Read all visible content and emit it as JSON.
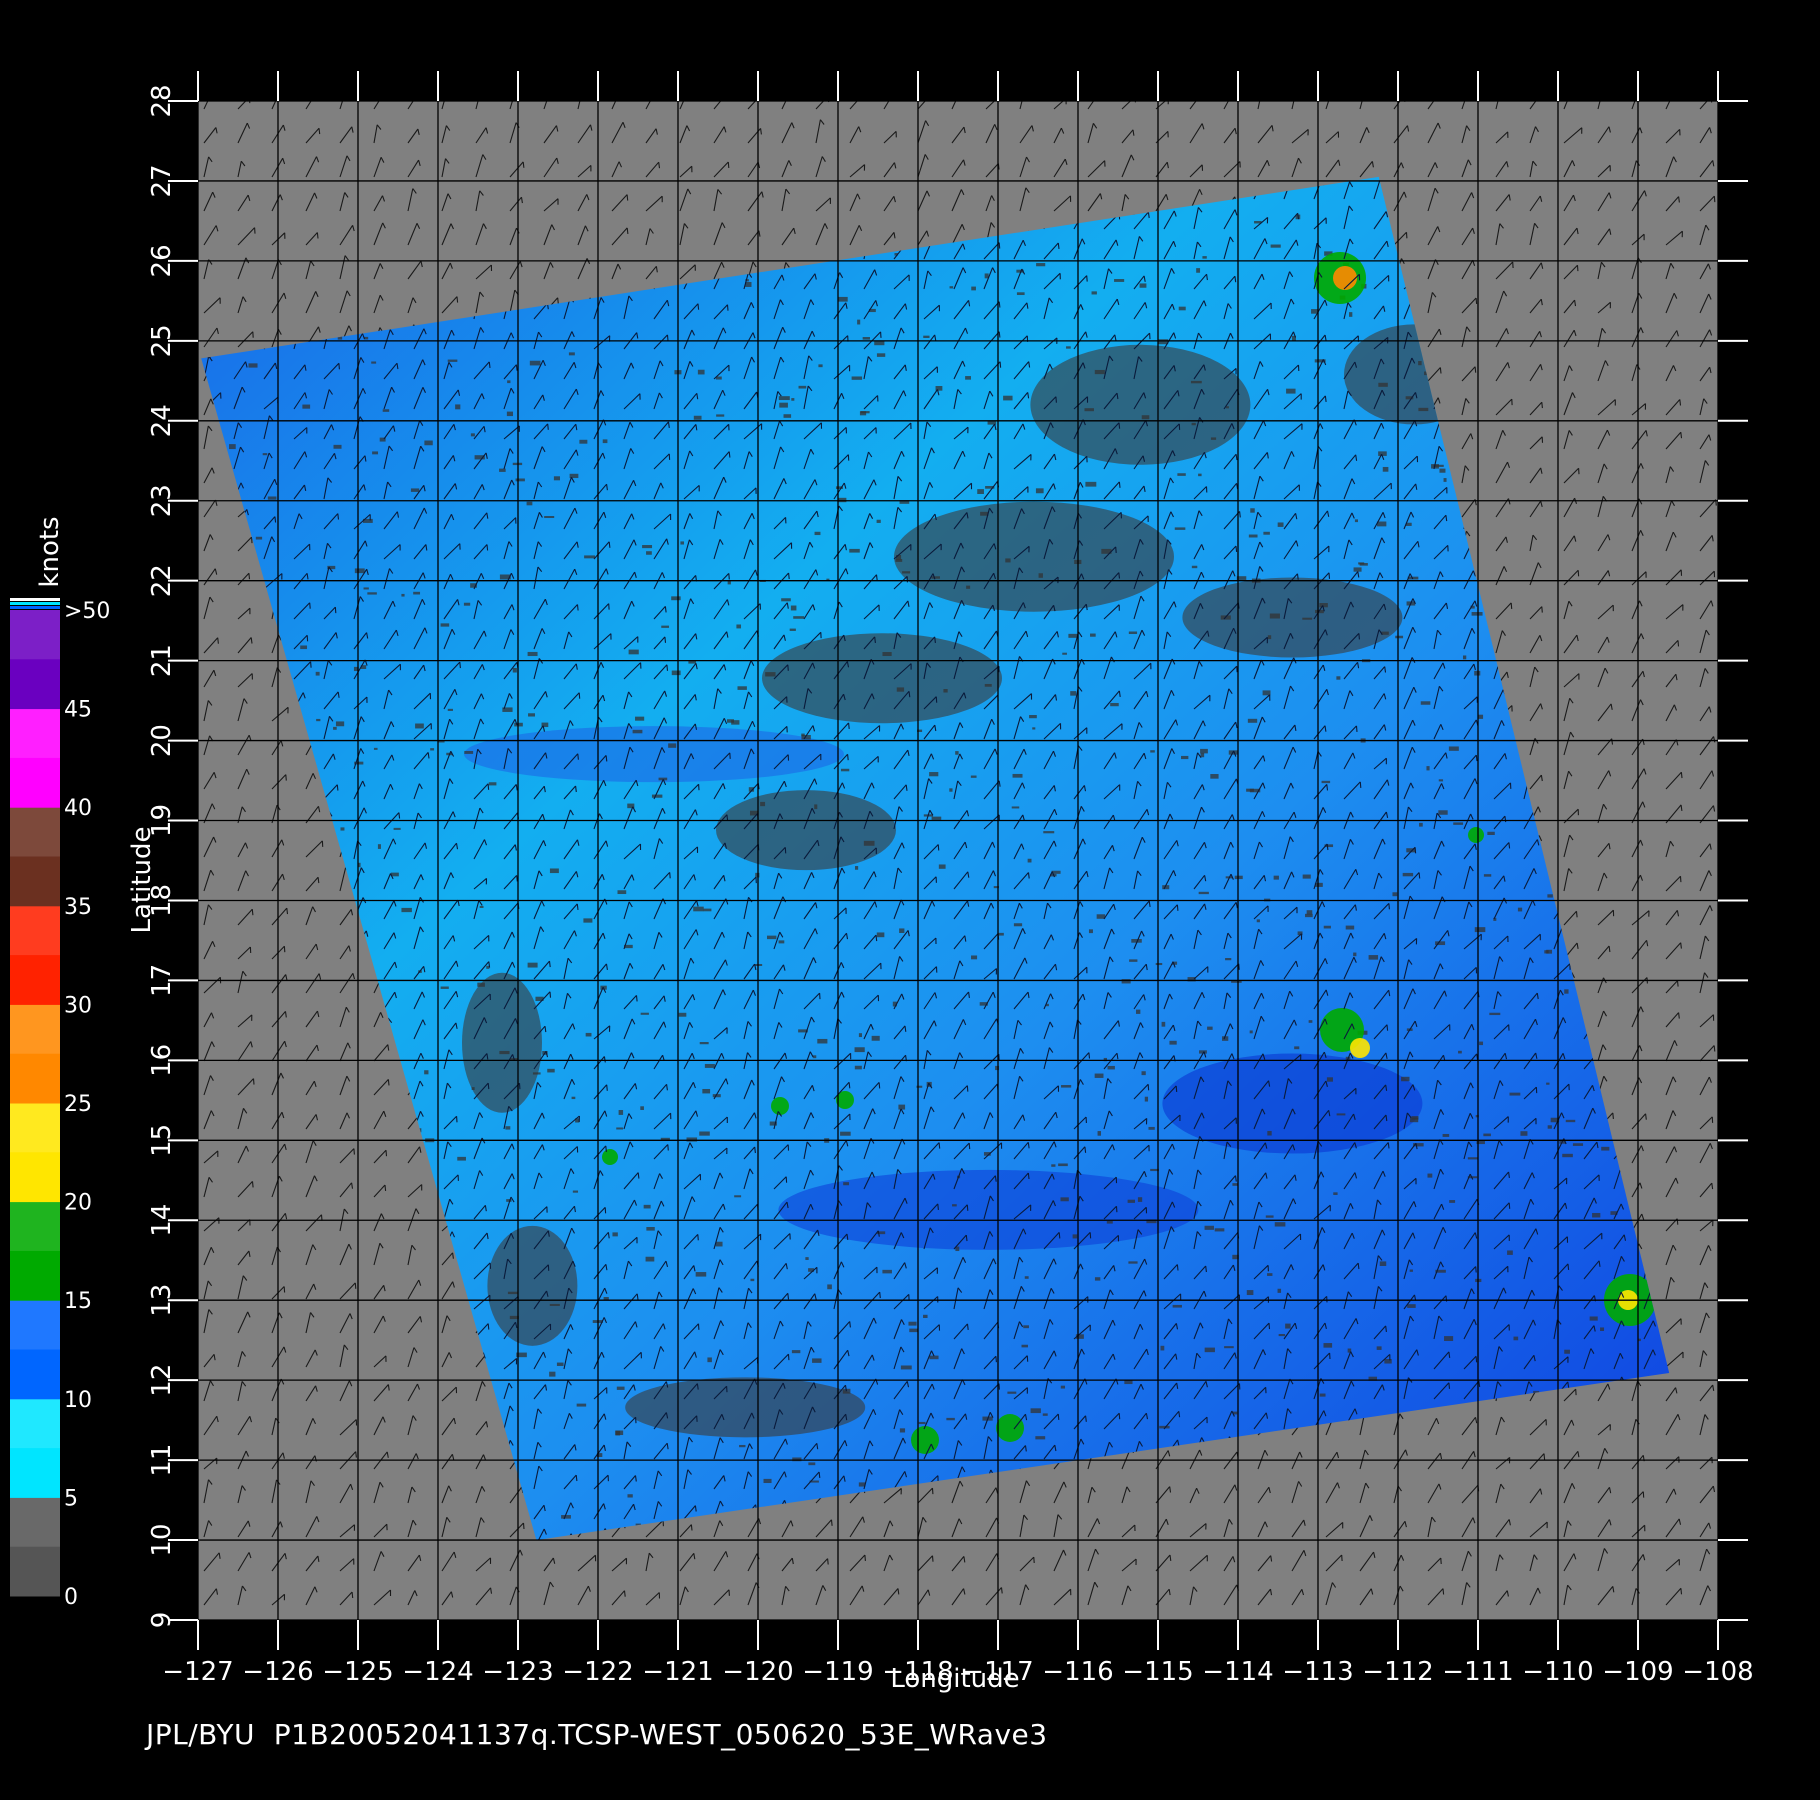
{
  "chart_data": {
    "type": "map",
    "xlabel": "Longitude",
    "ylabel": "Latitude",
    "xlim": [
      -127,
      -108
    ],
    "ylim": [
      9,
      28
    ],
    "x_ticks": [
      -127,
      -126,
      -125,
      -124,
      -123,
      -122,
      -121,
      -120,
      -119,
      -118,
      -117,
      -116,
      -115,
      -114,
      -113,
      -112,
      -111,
      -110,
      -109,
      -108
    ],
    "y_ticks": [
      9,
      10,
      11,
      12,
      13,
      14,
      15,
      16,
      17,
      18,
      19,
      20,
      21,
      22,
      23,
      24,
      25,
      26,
      27,
      28
    ],
    "swath_corners_lonlat": [
      [
        -126.96,
        24.78
      ],
      [
        -112.24,
        27.05
      ],
      [
        -108.61,
        12.09
      ],
      [
        -122.77,
        10.0
      ]
    ],
    "grid": true
  },
  "legend": {
    "title": "knots",
    "labels": [
      "0",
      "5",
      "10",
      "15",
      "20",
      "25",
      "30",
      "35",
      "40",
      "45",
      ">50"
    ],
    "colors": {
      "0-5": "#555555",
      "5-10": "#00e5ff",
      "10-15": "#0066ff",
      "15-20": "#00aa00",
      "20-25": "#ffe600",
      "25-30": "#ff8800",
      "30-35": "#ff2200",
      "35-40": "#6b3020",
      "40-45": "#ff00ff",
      ">50": "#6a00c0"
    }
  },
  "colors": {
    "background": "#000000",
    "land_nodata": "#808080",
    "swath_base": "#14b4ee",
    "grid": "#000000",
    "text": "#ffffff"
  },
  "footer": {
    "text": "JPL/BYU  P1B20052041137q.TCSP-WEST_050620_53E_WRave3"
  }
}
